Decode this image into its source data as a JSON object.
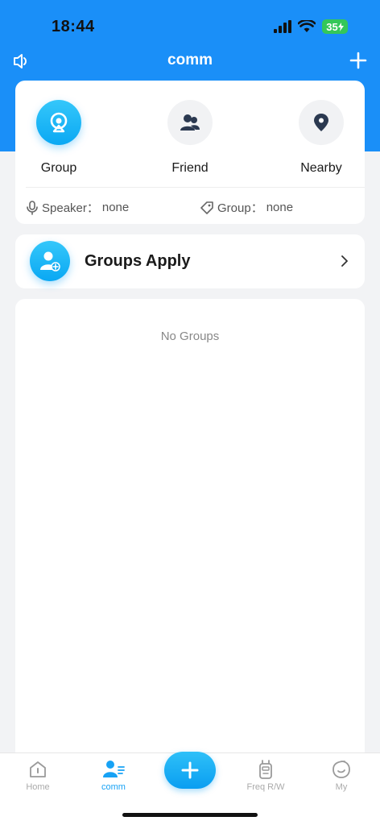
{
  "status_bar": {
    "time": "18:44",
    "battery": "35"
  },
  "nav": {
    "title": "comm"
  },
  "categories": [
    {
      "label": "Group",
      "icon": "group-camera-icon",
      "active": true
    },
    {
      "label": "Friend",
      "icon": "friends-icon",
      "active": false
    },
    {
      "label": "Nearby",
      "icon": "location-pin-icon",
      "active": false
    }
  ],
  "info": {
    "speaker_label": "Speaker：",
    "speaker_value": "none",
    "group_label": "Group：",
    "group_value": "none"
  },
  "apply": {
    "label": "Groups Apply"
  },
  "groups": {
    "empty_text": "No Groups"
  },
  "tabs": [
    {
      "label": "Home",
      "icon": "home-icon",
      "active": false
    },
    {
      "label": "comm",
      "icon": "comm-icon",
      "active": true
    },
    {
      "label": "Freq R/W",
      "icon": "walkie-talkie-icon",
      "active": false
    },
    {
      "label": "My",
      "icon": "profile-icon",
      "active": false
    }
  ],
  "colors": {
    "primary": "#1A8FF8",
    "accent": "#17A2F5",
    "background": "#F2F3F5"
  }
}
